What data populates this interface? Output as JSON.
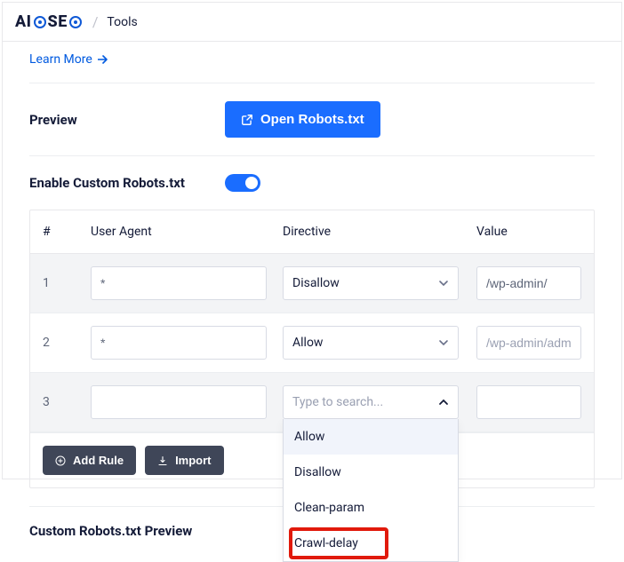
{
  "header": {
    "logo_text_left": "AI",
    "logo_text_right": "SE",
    "crumb": "Tools"
  },
  "links": {
    "learn_more": "Learn More"
  },
  "labels": {
    "preview": "Preview",
    "enable_custom": "Enable Custom Robots.txt",
    "custom_preview": "Custom Robots.txt Preview"
  },
  "buttons": {
    "open_robots": "Open Robots.txt",
    "add_rule": "Add Rule",
    "import": "Import"
  },
  "table": {
    "headers": {
      "num": "#",
      "ua": "User Agent",
      "dir": "Directive",
      "val": "Value"
    },
    "rows": [
      {
        "num": "1",
        "ua": "*",
        "dir": "Disallow",
        "val": "/wp-admin/",
        "gray": true
      },
      {
        "num": "2",
        "ua": "*",
        "dir": "Allow",
        "val": "/wp-admin/admin-ajax.php",
        "gray": false
      },
      {
        "num": "3",
        "ua": "",
        "dir_placeholder": "Type to search...",
        "val": "",
        "gray": true,
        "open": true
      }
    ]
  },
  "dropdown": {
    "options": [
      "Allow",
      "Disallow",
      "Clean-param",
      "Crawl-delay"
    ]
  }
}
